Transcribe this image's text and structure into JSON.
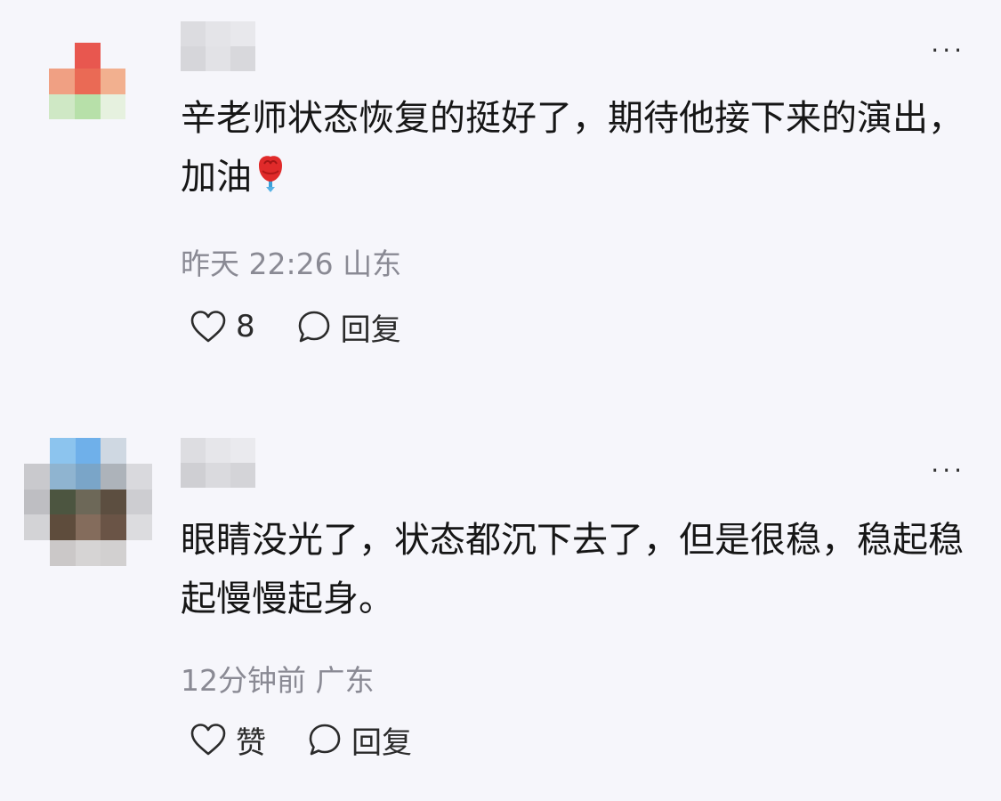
{
  "comments": [
    {
      "text": "辛老师状态恢复的挺好了，期待他接下来的演出，加油",
      "emoji": "rose",
      "time": "昨天 22:26",
      "location": "山东",
      "like_label": "8",
      "reply_label": "回复",
      "more_label": "···"
    },
    {
      "text": "眼睛没光了，状态都沉下去了，但是很稳，稳起稳起慢慢起身。",
      "time": "12分钟前",
      "location": "广东",
      "like_label": "赞",
      "reply_label": "回复",
      "more_label": "···"
    }
  ],
  "icons": {
    "like": "heart-outline-icon",
    "reply": "speech-bubble-icon",
    "more": "ellipsis-icon",
    "emoji": "rose-emoji"
  },
  "colors": {
    "background": "#f6f6fb",
    "text": "#161616",
    "meta": "#8a8a94",
    "rose": "#e02a2a"
  }
}
